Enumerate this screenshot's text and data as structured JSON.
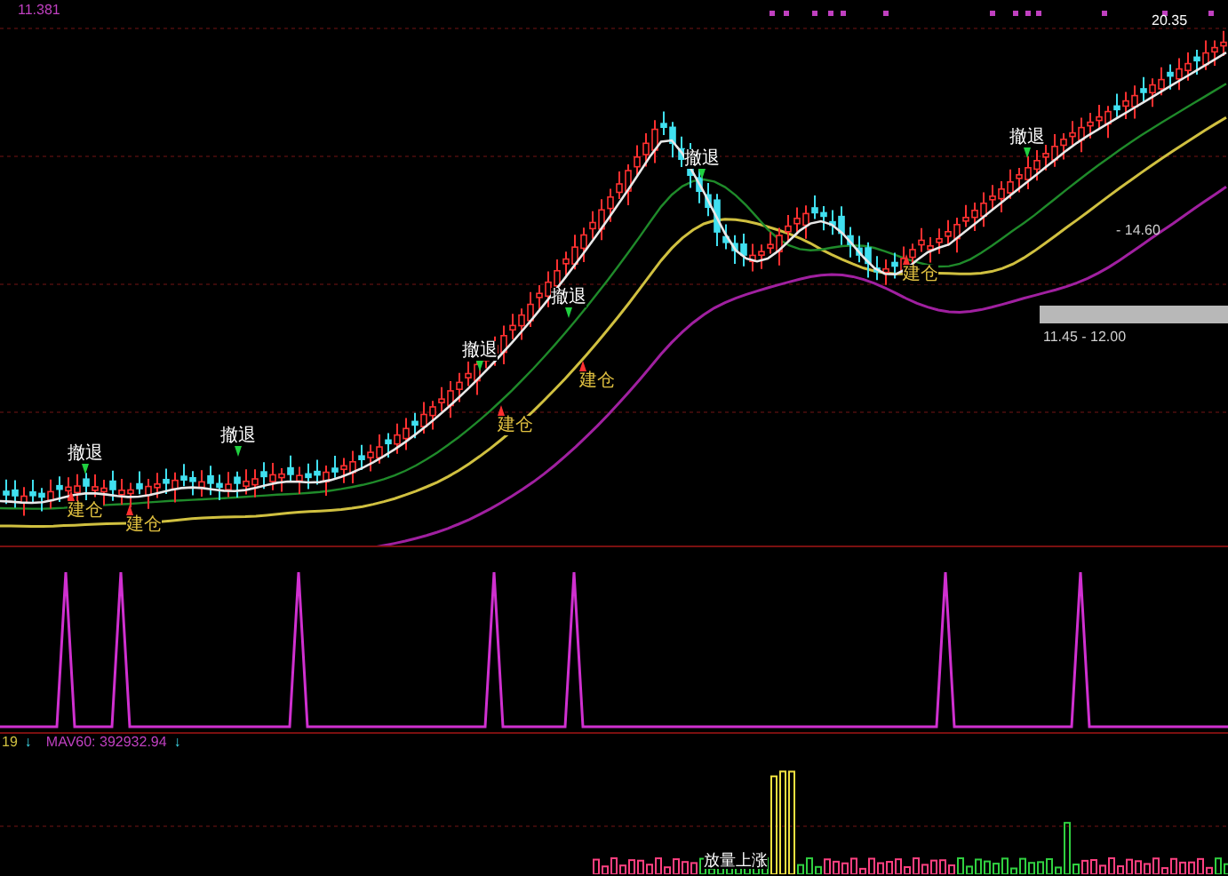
{
  "main_pane": {
    "last_price": "11.381",
    "high_label": "20.35",
    "range_upper": "- 14.60",
    "range_lower": "11.45 - 12.00",
    "signals": [
      {
        "kind": "sell",
        "label": "撤退"
      },
      {
        "kind": "buy",
        "label": "建仓"
      },
      {
        "kind": "buy",
        "label": "建仓"
      },
      {
        "kind": "sell",
        "label": "撤退"
      },
      {
        "kind": "sell",
        "label": "撤退"
      },
      {
        "kind": "buy",
        "label": "建仓"
      },
      {
        "kind": "sell",
        "label": "撤退"
      },
      {
        "kind": "buy",
        "label": "建仓"
      },
      {
        "kind": "sell",
        "label": "撤退"
      },
      {
        "kind": "buy",
        "label": "建仓"
      },
      {
        "kind": "sell",
        "label": "撤退"
      }
    ]
  },
  "volume_pane": {
    "legend_value": "19",
    "legend_arrow": "↓",
    "mav_label": "MAV60: 392932.94",
    "mav_arrow": "↓",
    "volume_note": "放量上涨"
  }
}
